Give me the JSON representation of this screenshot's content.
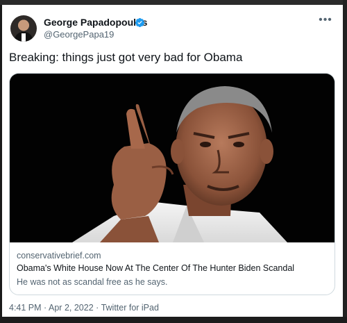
{
  "tweet": {
    "author": {
      "name": "George Papadopoulos",
      "handle": "@GeorgePapa19",
      "verified_color": "#1d9bf0"
    },
    "more_label": "•••",
    "text": "Breaking: things just got very bad for Obama",
    "link_card": {
      "domain": "conservativebrief.com",
      "title": "Obama's White House Now At The Center Of The Hunter Biden Scandal",
      "description": "He was not as scandal free as he says."
    },
    "meta": {
      "time": "4:41 PM",
      "separator": "·",
      "date": "Apr 2, 2022",
      "source": "Twitter for iPad"
    }
  },
  "icons": {
    "verified": "verified-badge-icon",
    "more": "more-options-icon"
  }
}
